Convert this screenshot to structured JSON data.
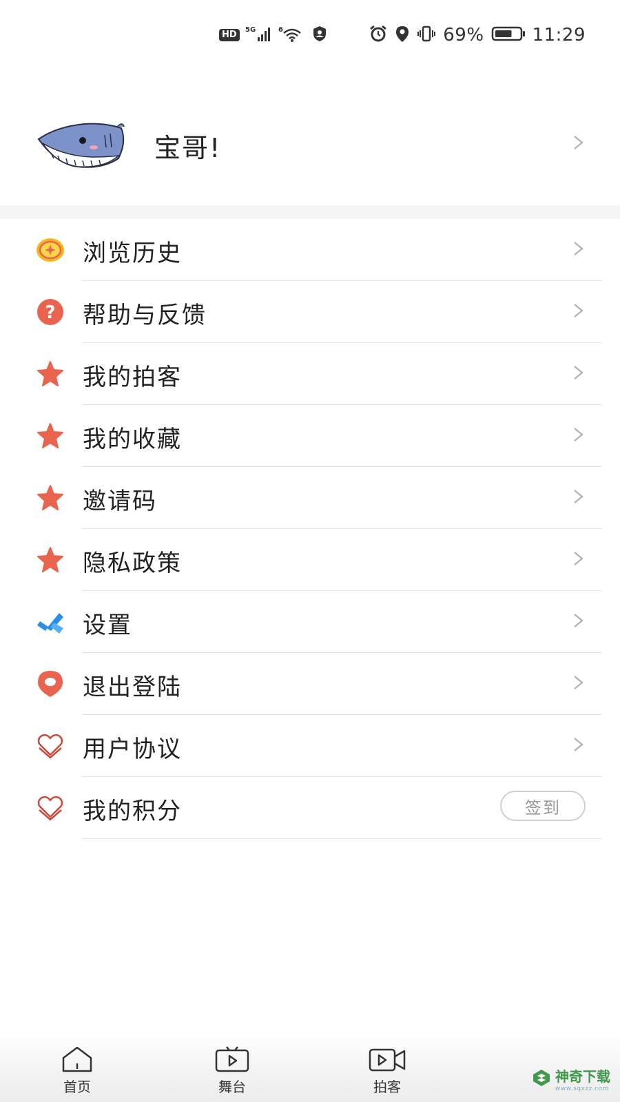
{
  "status_bar": {
    "hd": "HD",
    "signal_label": "5G",
    "wifi_label": "6",
    "battery_percent": "69%",
    "time": "11:29",
    "battery_level": 0.69
  },
  "profile": {
    "username": "宝哥!"
  },
  "menu": [
    {
      "label": "浏览历史",
      "icon": "coin-icon"
    },
    {
      "label": "帮助与反馈",
      "icon": "help-icon"
    },
    {
      "label": "我的拍客",
      "icon": "star-icon"
    },
    {
      "label": "我的收藏",
      "icon": "star-icon"
    },
    {
      "label": "邀请码",
      "icon": "star-icon"
    },
    {
      "label": "隐私政策",
      "icon": "star-icon"
    },
    {
      "label": "设置",
      "icon": "tools-icon"
    },
    {
      "label": "退出登陆",
      "icon": "location-pin-icon"
    },
    {
      "label": "用户协议",
      "icon": "heart-icon"
    },
    {
      "label": "我的积分",
      "icon": "heart-icon",
      "action_label": "签到"
    }
  ],
  "bottom_nav": [
    {
      "label": "首页",
      "icon": "home-icon"
    },
    {
      "label": "舞台",
      "icon": "tv-play-icon"
    },
    {
      "label": "拍客",
      "icon": "video-camera-icon"
    }
  ],
  "watermark": {
    "text": "神奇下载",
    "sub": "www.sqxzz.com"
  },
  "colors": {
    "accent_red": "#e8644f",
    "tools_blue": "#2b8fe6",
    "coin_yellow": "#f3b81c",
    "divider": "#e6e6e6",
    "section_gap": "#f5f5f5"
  }
}
